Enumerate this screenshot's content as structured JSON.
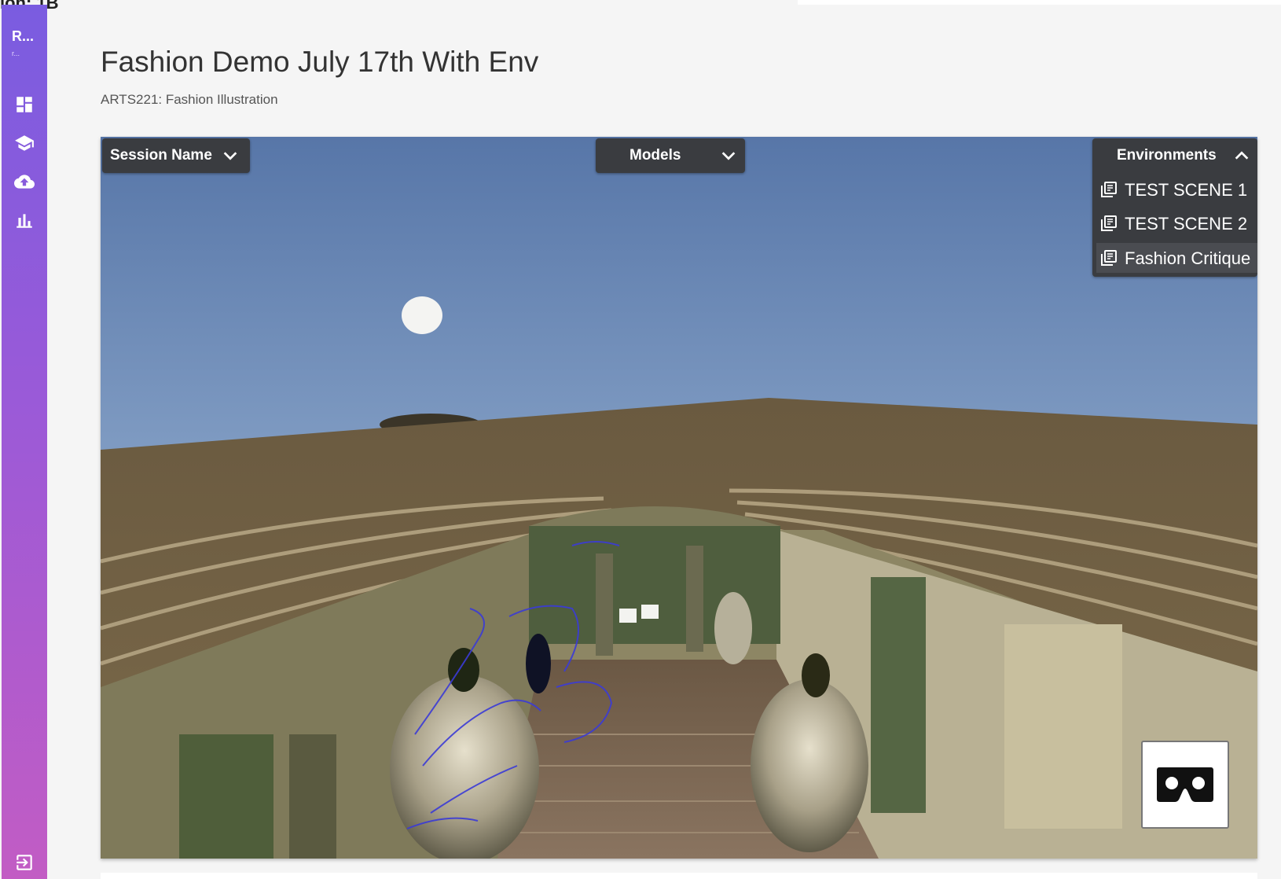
{
  "page": {
    "top_crop_text": "ion: 1B",
    "title": "Fashion Demo July 17th With Env",
    "subtitle": "ARTS221: Fashion Illustration"
  },
  "sidebar": {
    "brand": "R...",
    "brand_sub": "r...",
    "items": [
      {
        "icon": "dashboard-icon"
      },
      {
        "icon": "school-icon"
      },
      {
        "icon": "cloud-upload-icon"
      },
      {
        "icon": "bar-chart-icon"
      }
    ],
    "footer_icon": "exit-icon",
    "gradient": [
      "#7a5ce0",
      "#c25cc4"
    ]
  },
  "viewer": {
    "session_dropdown": {
      "label": "Session Name",
      "icon": "chevron-down-icon"
    },
    "models_dropdown": {
      "label": "Models",
      "icon": "chevron-down-icon"
    },
    "environments_dropdown": {
      "label": "Environments",
      "icon": "chevron-up-icon",
      "items": [
        {
          "label": "TEST SCENE 1",
          "icon": "library-icon"
        },
        {
          "label": "TEST SCENE 2",
          "icon": "library-icon"
        },
        {
          "label": "Fashion Critique",
          "icon": "library-icon",
          "selected": true
        }
      ]
    },
    "vr_button": {
      "icon": "cardboard-vr-icon"
    },
    "colors": {
      "sky_top": "#5a80b8",
      "sky_bottom": "#9ab4d2",
      "wood": "#6e5b3f",
      "wall": "#8b8560",
      "dropdown_bg": "#3a3c40"
    }
  }
}
